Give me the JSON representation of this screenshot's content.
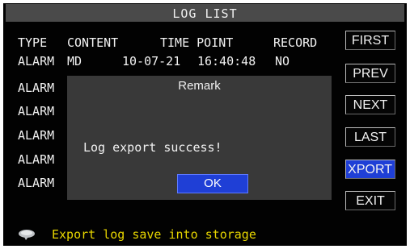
{
  "window": {
    "title": "LOG LIST"
  },
  "table": {
    "headers": [
      "TYPE",
      "CONTENT",
      "TIME POINT",
      "RECORD"
    ],
    "rows": [
      {
        "type": "ALARM",
        "content": "MD",
        "date": "10-07-21",
        "time": "16:40:48",
        "record": "NO"
      },
      {
        "type": "ALARM"
      },
      {
        "type": "ALARM"
      },
      {
        "type": "ALARM"
      },
      {
        "type": "ALARM"
      },
      {
        "type": "ALARM"
      }
    ]
  },
  "buttons": {
    "first": "FIRST",
    "prev": "PREV",
    "next": "NEXT",
    "last": "LAST",
    "export": "XPORT",
    "exit": "EXIT"
  },
  "dialog": {
    "title": "Remark",
    "message": "Log export success!",
    "ok": "OK"
  },
  "status": {
    "icon": "speech-bubble-icon",
    "text": "Export log save into storage"
  },
  "colors": {
    "background": "#020202",
    "titlebar": "#4a4a4a",
    "dialog": "#393939",
    "accent": "#1f3fd6",
    "status_text": "#e8d600"
  }
}
